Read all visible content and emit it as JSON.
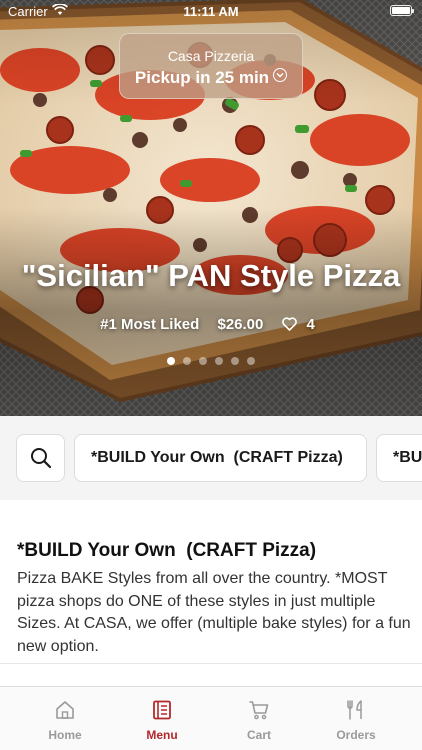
{
  "status_bar": {
    "carrier": "Carrier",
    "time": "11:11 AM"
  },
  "pickup": {
    "store_name": "Casa Pizzeria",
    "pickup_label": "Pickup in 25 min"
  },
  "featured": {
    "title": "\"Sicilian\" PAN Style Pizza",
    "badge": "#1 Most Liked",
    "price": "$26.00",
    "likes": "4",
    "carousel_pages": 6,
    "carousel_active_index": 0
  },
  "categories": {
    "items": [
      {
        "label": "*BUILD Your Own  (CRAFT Pizza)"
      },
      {
        "label": "*BUILD Your Own  (CRAFT Pizza)"
      }
    ]
  },
  "section": {
    "title": "*BUILD Your Own  (CRAFT Pizza)",
    "description": "Pizza BAKE Styles from all over the country. *MOST pizza shops do ONE of these styles in just multiple Sizes. At CASA, we offer (multiple bake styles) for a fun new option."
  },
  "tab_bar": {
    "tabs": [
      {
        "label": "Home",
        "icon": "home-icon"
      },
      {
        "label": "Menu",
        "icon": "menu-icon"
      },
      {
        "label": "Cart",
        "icon": "cart-icon"
      },
      {
        "label": "Orders",
        "icon": "orders-icon"
      }
    ],
    "active": "Menu"
  },
  "colors": {
    "accent": "#b3282d",
    "inactive_tab": "#9a9a9a",
    "background": "#f4f4f4"
  }
}
